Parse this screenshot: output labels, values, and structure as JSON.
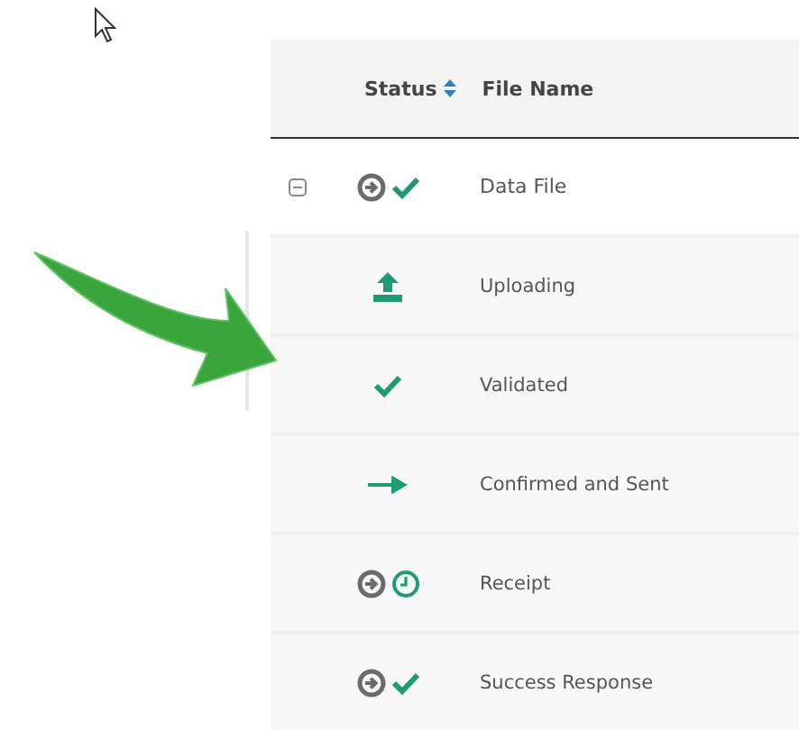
{
  "table": {
    "columns": [
      {
        "label": "Status",
        "sortable": true
      },
      {
        "label": "File Name",
        "sortable": false
      }
    ],
    "rows": [
      {
        "name": "Data File",
        "icons": [
          {
            "kind": "circle-arrow"
          },
          {
            "kind": "check"
          }
        ],
        "expanded": true,
        "children": [
          {
            "name": "Uploading",
            "icons": [
              {
                "kind": "upload"
              }
            ]
          },
          {
            "name": "Validated",
            "icons": [
              {
                "kind": "check"
              }
            ]
          },
          {
            "name": "Confirmed and Sent",
            "icons": [
              {
                "kind": "arrow"
              }
            ]
          },
          {
            "name": "Receipt",
            "icons": [
              {
                "kind": "circle-arrow"
              },
              {
                "kind": "clock"
              }
            ]
          },
          {
            "name": "Success Response",
            "icons": [
              {
                "kind": "circle-arrow"
              },
              {
                "kind": "check"
              }
            ]
          }
        ]
      }
    ]
  }
}
